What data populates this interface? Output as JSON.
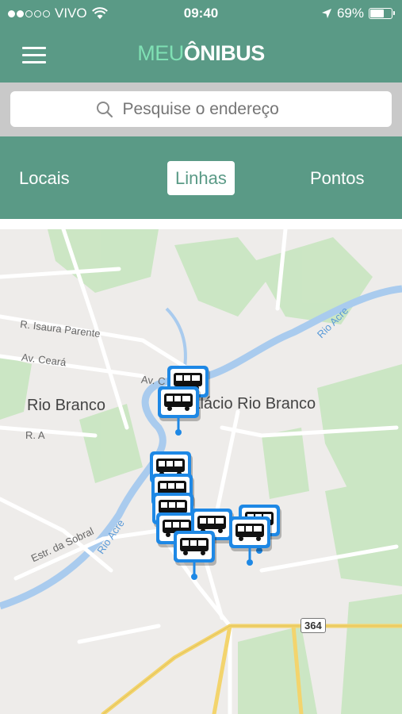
{
  "status_bar": {
    "carrier": "VIVO",
    "time": "09:40",
    "battery": "69%",
    "battery_level": 0.69
  },
  "header": {
    "logo_part1": "MEU",
    "logo_part2": "ÔNIBUS"
  },
  "search": {
    "placeholder": "Pesquise o endereço"
  },
  "tabs": [
    {
      "label": "Locais",
      "active": false
    },
    {
      "label": "Linhas",
      "active": true
    },
    {
      "label": "Pontos",
      "active": false
    }
  ],
  "map": {
    "city_labels": [
      "Rio Branco",
      "Palácio Rio Branco"
    ],
    "street_labels": [
      "R. Isaura Parente",
      "Av. Ceará",
      "Av. C",
      "R. A",
      "Estr. da Sobral"
    ],
    "river_labels": [
      "Rio Acre",
      "Rio Acre"
    ],
    "highway_shield": "364",
    "colors": {
      "water": "#a9cbee",
      "park": "#c8e6c0",
      "road": "#ffffff",
      "highway": "#f3d46d"
    }
  },
  "colors": {
    "primary": "#5a9a86",
    "logo_accent": "#7fe0b4",
    "marker": "#1e88e5"
  }
}
